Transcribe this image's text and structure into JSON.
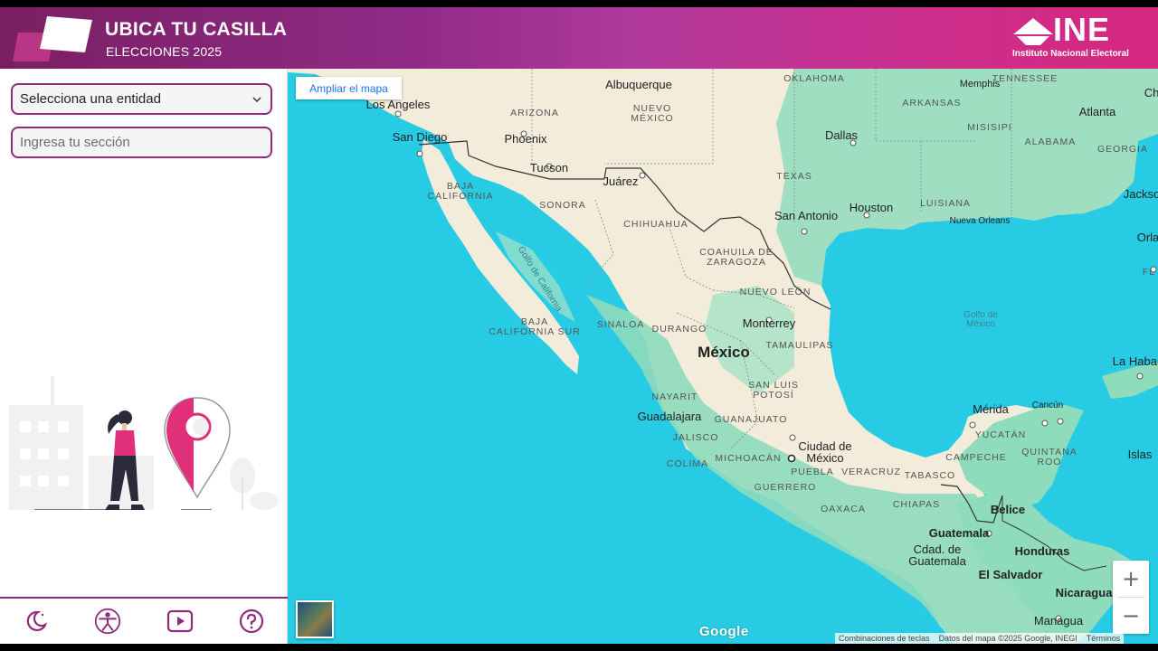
{
  "header": {
    "title": "UBICA TU CASILLA",
    "subtitle": "ELECCIONES 2025",
    "logo_text": "INE",
    "logo_subtext": "Instituto Nacional Electoral",
    "gradient_colors": [
      "#7a1f63",
      "#d6287f"
    ]
  },
  "sidebar": {
    "entity_select": {
      "value": "Selecciona una entidad"
    },
    "section_input": {
      "placeholder": "Ingresa tu sección"
    },
    "bottom_icons": [
      "moon-icon",
      "accessibility-icon",
      "video-play-icon",
      "help-icon"
    ],
    "accent_color": "#8e2b7a"
  },
  "map": {
    "enlarge_label": "Ampliar el mapa",
    "zoom_in": "+",
    "zoom_out": "−",
    "google": "Google",
    "attribution": [
      "Combinaciones de teclas",
      "Datos del mapa ©2025 Google, INEGI",
      "Términos"
    ],
    "labels": {
      "oklahoma": "OKLAHOMA",
      "tennessee": "TENNESSEE",
      "memphis": "Memphis",
      "ch": "Ch",
      "arkansas": "ARKANSAS",
      "albuquerque": "Albuquerque",
      "los_angeles": "Los Angeles",
      "arizona": "ARIZONA",
      "nuevo_mexico": "NUEVO\nMÉXICO",
      "misisipi": "MISISIPI",
      "atlanta": "Atlanta",
      "alabama": "ALABAMA",
      "georgia": "GEORGIA",
      "dallas": "Dallas",
      "san_diego": "San Diego",
      "phoenix": "Phoenix",
      "tucson": "Tucson",
      "texas": "TEXAS",
      "juarez": "Juárez",
      "baja_california": "BAJA\nCALIFORNIA",
      "sonora": "SONORA",
      "jackso": "Jackso",
      "luisiana": "LUISIANA",
      "houston": "Houston",
      "chihuahua": "CHIHUAHUA",
      "san_antonio": "San Antonio",
      "nueva_orleans": "Nueva Orleans",
      "orla": "Orla",
      "fl": "FL",
      "coahuila": "COAHUILA DE\nZARAGOZA",
      "golfo_california": "Golfo de California",
      "nuevo_leon": "NUEVO LEÓN",
      "golfo_mexico": "Golfo de\nMéxico",
      "baja_california_sur": "BAJA\nCALIFORNIA SUR",
      "sinaloa": "SINALOA",
      "durango": "DURANGO",
      "monterrey": "Monterrey",
      "mexico": "México",
      "tamaulipas": "TAMAULIPAS",
      "la_habana": "La Haban",
      "san_luis": "SAN LUIS\nPOTOSÍ",
      "nayarit": "NAYARIT",
      "merida": "Mérida",
      "cancun": "Cancún",
      "guadalajara": "Guadalajara",
      "guanajuato": "GUANAJUATO",
      "yucatan": "YUCATÁN",
      "jalisco": "JALISCO",
      "cdmx": "Ciudad de\nMéxico",
      "quintana_roo": "QUINTANA\nROO",
      "campeche": "CAMPECHE",
      "islas": "Islas",
      "colima": "COLIMA",
      "michoacan": "MICHOACÁN",
      "puebla": "PUEBLA",
      "veracruz": "VERACRUZ",
      "tabasco": "TABASCO",
      "guerrero": "GUERRERO",
      "chiapas": "CHIAPAS",
      "belice": "Belice",
      "oaxaca": "OAXACA",
      "guatemala_country": "Guatemala",
      "cdad_guatemala": "Cdad. de\nGuatemala",
      "honduras": "Honduras",
      "el_salvador": "El Salvador",
      "nicaragua": "Nicaragua",
      "managua": "Managua"
    },
    "colors": {
      "water": "#27cce4",
      "land": "#f3ecdb",
      "vegetation": "#7fd8b4"
    }
  }
}
